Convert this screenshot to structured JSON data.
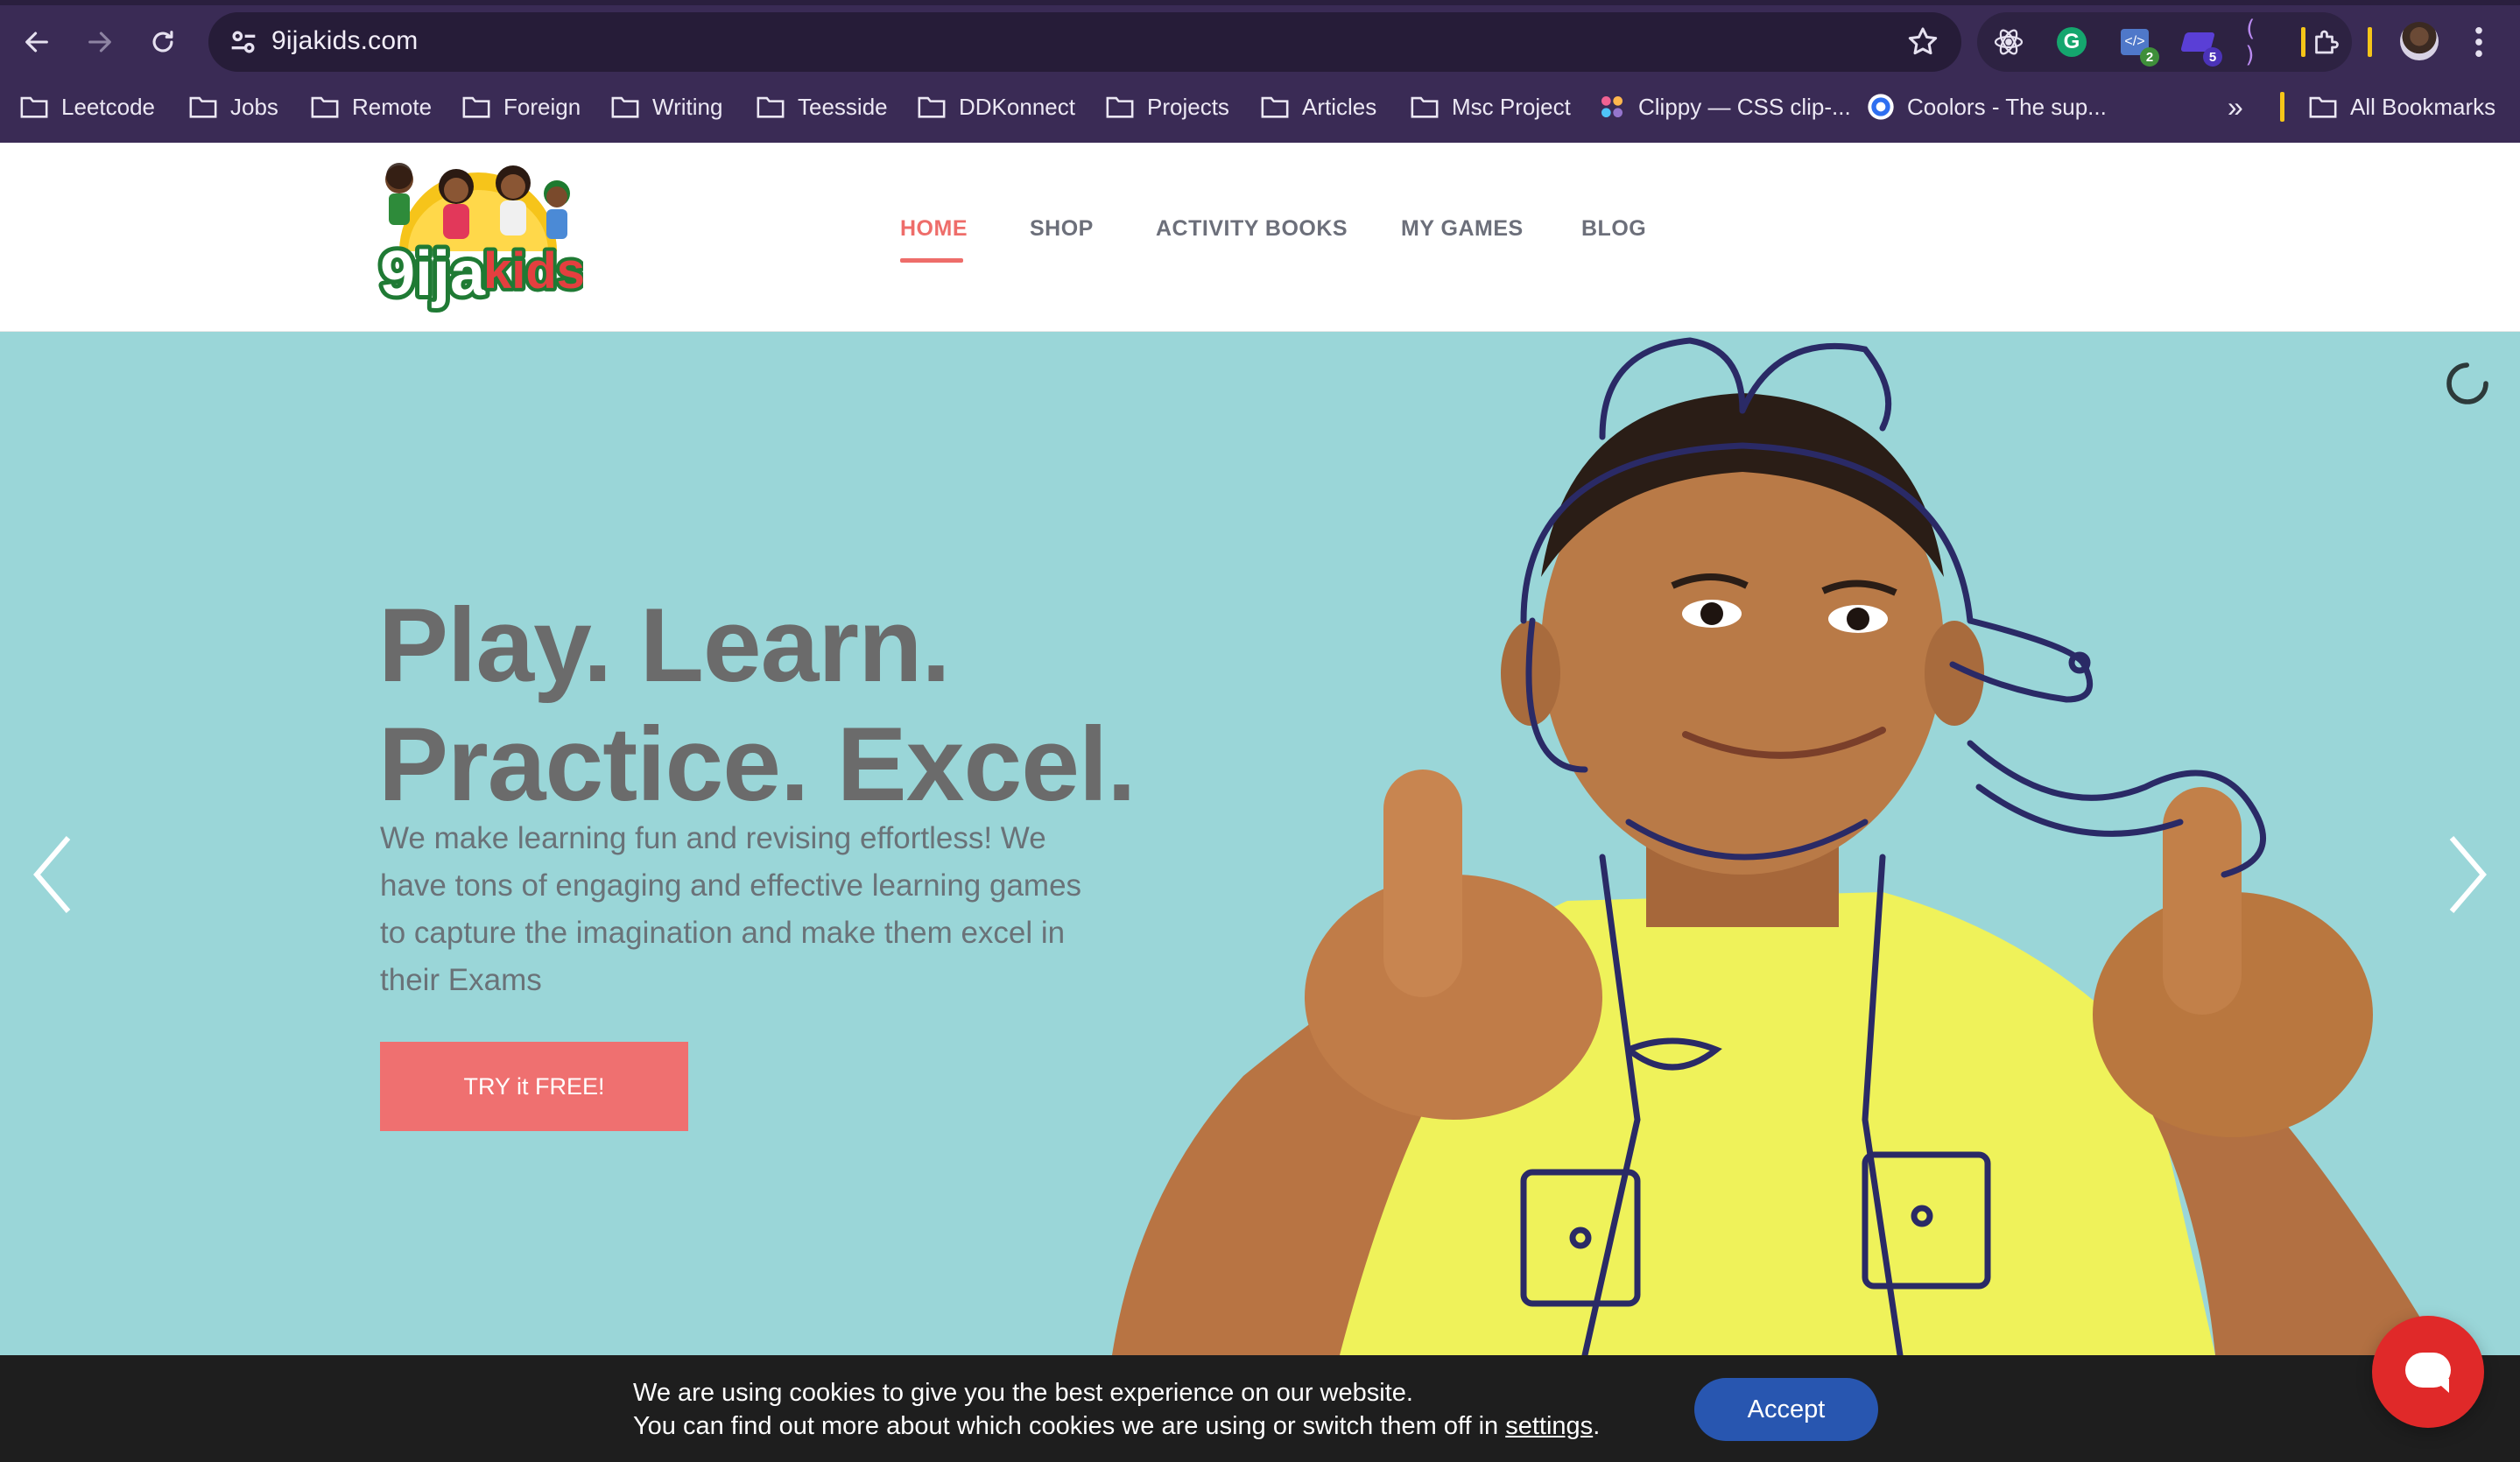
{
  "browser": {
    "url": "9ijakids.com",
    "bookmarks": [
      {
        "label": "Leetcode",
        "type": "folder"
      },
      {
        "label": "Jobs",
        "type": "folder"
      },
      {
        "label": "Remote",
        "type": "folder"
      },
      {
        "label": "Foreign",
        "type": "folder"
      },
      {
        "label": "Writing",
        "type": "folder"
      },
      {
        "label": "Teesside",
        "type": "folder"
      },
      {
        "label": "DDKonnect",
        "type": "folder"
      },
      {
        "label": "Projects",
        "type": "folder"
      },
      {
        "label": "Articles",
        "type": "folder"
      },
      {
        "label": "Msc Project",
        "type": "folder"
      },
      {
        "label": "Clippy — CSS clip-...",
        "type": "site"
      },
      {
        "label": "Coolors - The sup...",
        "type": "site"
      }
    ],
    "overflow_label": "»",
    "all_bookmarks": "All Bookmarks",
    "extension_badges": [
      "2",
      "5"
    ]
  },
  "site": {
    "logo_text": "9ijakids",
    "nav": [
      "HOME",
      "SHOP",
      "ACTIVITY BOOKS",
      "MY GAMES",
      "BLOG"
    ],
    "active_nav": "HOME"
  },
  "hero": {
    "title_line1": "Play. Learn.",
    "title_line2": "Practice. Excel.",
    "paragraph": "We make learning fun and revising effortless! We have tons of engaging and effective learning games to capture the imagination and make them excel in their Exams",
    "cta_label": "TRY it FREE!"
  },
  "cookie": {
    "line1": "We are using cookies to give you the best experience on our website.",
    "line2_prefix": "You can find out more about which cookies we are using or switch them off in ",
    "line2_link": "settings",
    "line2_suffix": ".",
    "accept_label": "Accept"
  },
  "colors": {
    "chrome_bg": "#3a2b55",
    "hero_bg": "#9ad6d8",
    "accent": "#ee6d6a",
    "cta_bg": "#ef7070",
    "cookie_bg": "#1e1e1e",
    "accept_bg": "#2856b0",
    "chat_bg": "#e02929"
  },
  "icons": [
    "back-arrow-icon",
    "forward-arrow-icon",
    "reload-icon",
    "site-settings-icon",
    "star-icon",
    "extensions-icon",
    "kebab-menu-icon",
    "folder-icon",
    "chevron-left-icon",
    "chevron-right-icon",
    "loading-spinner-icon",
    "chat-icon"
  ]
}
